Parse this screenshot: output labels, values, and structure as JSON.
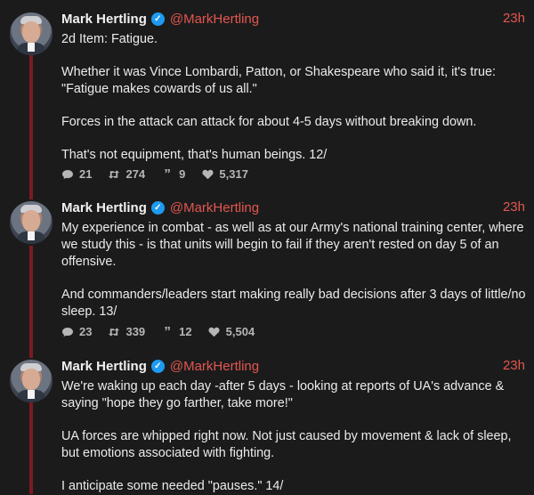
{
  "tweets": [
    {
      "name": "Mark Hertling",
      "handle": "@MarkHertling",
      "time": "23h",
      "paragraphs": [
        "2d Item: Fatigue.",
        "Whether it was Vince Lombardi, Patton, or Shakespeare who said it, it's true:\n\"Fatigue makes cowards of us all.\"",
        "Forces in the attack can attack for about 4-5 days without breaking down.",
        "That's not equipment, that's human beings. 12/"
      ],
      "stats": {
        "replies": "21",
        "retweets": "274",
        "quotes": "9",
        "likes": "5,317"
      }
    },
    {
      "name": "Mark Hertling",
      "handle": "@MarkHertling",
      "time": "23h",
      "paragraphs": [
        "My experience in combat - as well as at our Army's national training center, where we study this - is that units will begin to fail if they aren't rested on day 5 of an offensive.",
        "And commanders/leaders start making really bad decisions after 3 days of little/no sleep. 13/"
      ],
      "stats": {
        "replies": "23",
        "retweets": "339",
        "quotes": "12",
        "likes": "5,504"
      }
    },
    {
      "name": "Mark Hertling",
      "handle": "@MarkHertling",
      "time": "23h",
      "paragraphs": [
        "We're waking up each day -after 5 days - looking at reports of UA's advance & saying \"hope they go farther, take more!\"",
        "UA forces are whipped right now. Not just caused by movement & lack of sleep, but emotions associated with fighting.",
        "I anticipate some needed \"pauses.\" 14/"
      ],
      "stats": null
    }
  ],
  "icons": {
    "verified": "verified-badge-icon",
    "reply": "speech-bubble-icon",
    "retweet": "retweet-arrows-icon",
    "quote": "quote-marks-icon",
    "like": "heart-icon"
  },
  "colors": {
    "background": "#1c1b1c",
    "accent": "#e1574f",
    "thread_line": "#7a1a22",
    "verified": "#1d9bf0"
  }
}
